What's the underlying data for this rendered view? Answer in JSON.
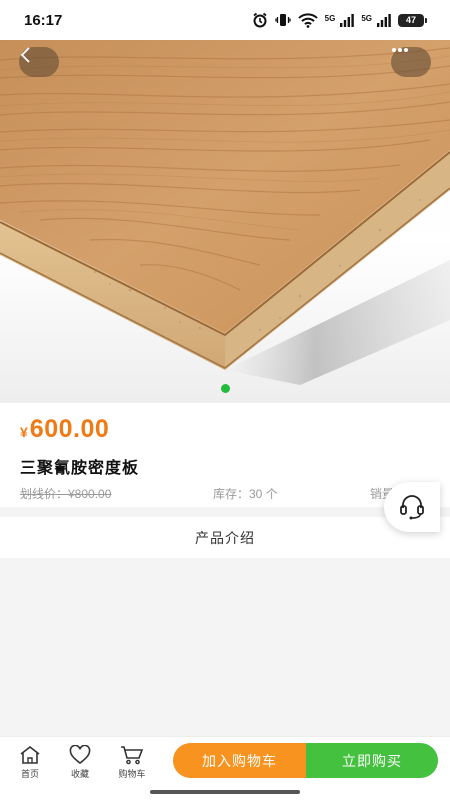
{
  "status_bar": {
    "time": "16:17",
    "icons": [
      "alarm-icon",
      "vibrate-icon",
      "wifi-icon",
      "signal-5g-icon",
      "signal-5g-icon",
      "battery-icon"
    ],
    "signal_labels": [
      "5G",
      "5G"
    ],
    "battery": "47"
  },
  "gallery": {
    "image": "laminated-particle-board",
    "slide_count": 1,
    "active_slide": 1
  },
  "product": {
    "currency": "¥",
    "price": "600.00",
    "name": "三聚氰胺密度板",
    "original_price": "划线价：¥800.00",
    "stock": "库存：30 个",
    "sales": "销量"
  },
  "tabs": {
    "intro": "产品介绍"
  },
  "bottom_nav": {
    "home": "首页",
    "favorite": "收藏",
    "cart": "购物车",
    "add_to_cart": "加入购物车",
    "buy_now": "立即购买"
  },
  "colors": {
    "price": "#f07a14",
    "add_to_cart": "#f7931e",
    "buy_now": "#44c23f",
    "active_dot": "#22bb3b"
  }
}
